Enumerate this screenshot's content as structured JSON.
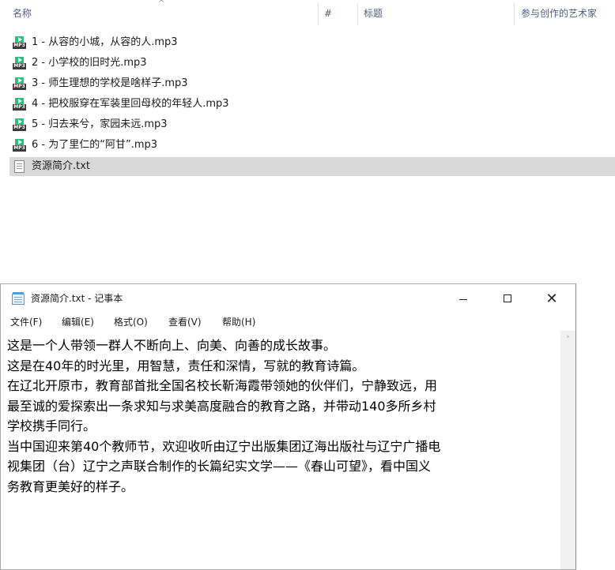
{
  "explorer": {
    "columns": {
      "name": "名称",
      "number": "#",
      "title": "标题",
      "artists": "参与创作的艺术家"
    },
    "sort_arrow": "^",
    "files": [
      {
        "name": "1 - 从容的小城，从容的人.mp3",
        "icon": "mp3-file-icon"
      },
      {
        "name": "2 - 小学校的旧时光.mp3",
        "icon": "mp3-file-icon"
      },
      {
        "name": "3 - 师生理想的学校是啥样子.mp3",
        "icon": "mp3-file-icon"
      },
      {
        "name": "4 - 把校服穿在军装里回母校的年轻人.mp3",
        "icon": "mp3-file-icon"
      },
      {
        "name": "5 - 归去来兮，家园未远.mp3",
        "icon": "mp3-file-icon"
      },
      {
        "name": "6 - 为了里仁的“阿甘”.mp3",
        "icon": "mp3-file-icon"
      },
      {
        "name": "资源简介.txt",
        "icon": "text-file-icon",
        "selected": true
      }
    ]
  },
  "notepad": {
    "title": "资源简介.txt - 记事本",
    "window_controls": {
      "minimize": "—",
      "close": "✕"
    },
    "menu": [
      "文件(F)",
      "编辑(E)",
      "格式(O)",
      "查看(V)",
      "帮助(H)"
    ],
    "content_lines": [
      "这是一个人带领一群人不断向上、向美、向善的成长故事。",
      "这是在40年的时光里，用智慧，责任和深情，写就的教育诗篇。",
      "在辽北开原市，教育部首批全国名校长靳海霞带领她的伙伴们，宁静致远，用",
      "最至诚的爱探索出一条求知与求美高度融合的教育之路，并带动140多所乡村",
      "学校携手同行。",
      "当中国迎来第40个教师节，欢迎收听由辽宁出版集团辽海出版社与辽宁广播电",
      "视集团（台）辽宁之声联合制作的长篇纪实文学——《春山可望》，看中国义",
      "务教育更美好的样子。"
    ],
    "scroll_up_glyph": "˄"
  }
}
